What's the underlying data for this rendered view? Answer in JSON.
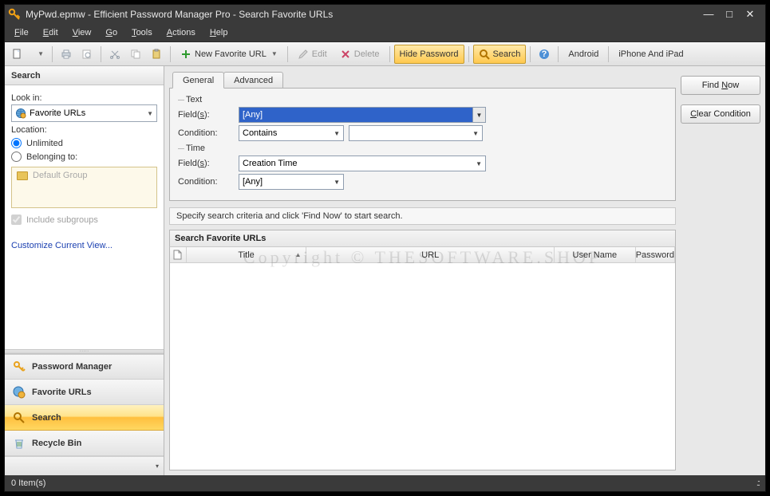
{
  "title": "MyPwd.epmw - Efficient Password Manager Pro - Search Favorite URLs",
  "menus": {
    "file": "File",
    "edit": "Edit",
    "view": "View",
    "go": "Go",
    "tools": "Tools",
    "actions": "Actions",
    "help": "Help"
  },
  "toolbar": {
    "new_fav": "New Favorite URL",
    "edit": "Edit",
    "delete": "Delete",
    "hide_pwd": "Hide Password",
    "search": "Search",
    "android": "Android",
    "iphone": "iPhone And iPad"
  },
  "sidebar": {
    "title": "Search",
    "look_in_label": "Look in:",
    "look_in_value": "Favorite URLs",
    "location_label": "Location:",
    "radio_unlimited": "Unlimited",
    "radio_belonging": "Belonging to:",
    "group_default": "Default Group",
    "include_sub": "Include subgroups",
    "customize": "Customize Current View...",
    "nav": {
      "pm": "Password Manager",
      "fav": "Favorite URLs",
      "search": "Search",
      "recycle": "Recycle Bin"
    }
  },
  "tabs": {
    "general": "General",
    "advanced": "Advanced"
  },
  "fs_text": {
    "legend": "Text",
    "fields_label": "Field(s):",
    "fields_value": "[Any]",
    "condition_label": "Condition:",
    "condition_value": "Contains",
    "condition_value2": ""
  },
  "fs_time": {
    "legend": "Time",
    "fields_label": "Field(s):",
    "fields_value": "Creation Time",
    "condition_label": "Condition:",
    "condition_value": "[Any]"
  },
  "hint": "Specify search criteria and click 'Find Now' to start search.",
  "buttons": {
    "find_now": "Find Now",
    "clear": "Clear Condition"
  },
  "results": {
    "title": "Search Favorite URLs",
    "cols": {
      "title": "Title",
      "url": "URL",
      "user": "User Name",
      "pwd": "Password"
    }
  },
  "watermark": "Copyright © THESOFTWARE.SHOP",
  "status": "0 Item(s)"
}
